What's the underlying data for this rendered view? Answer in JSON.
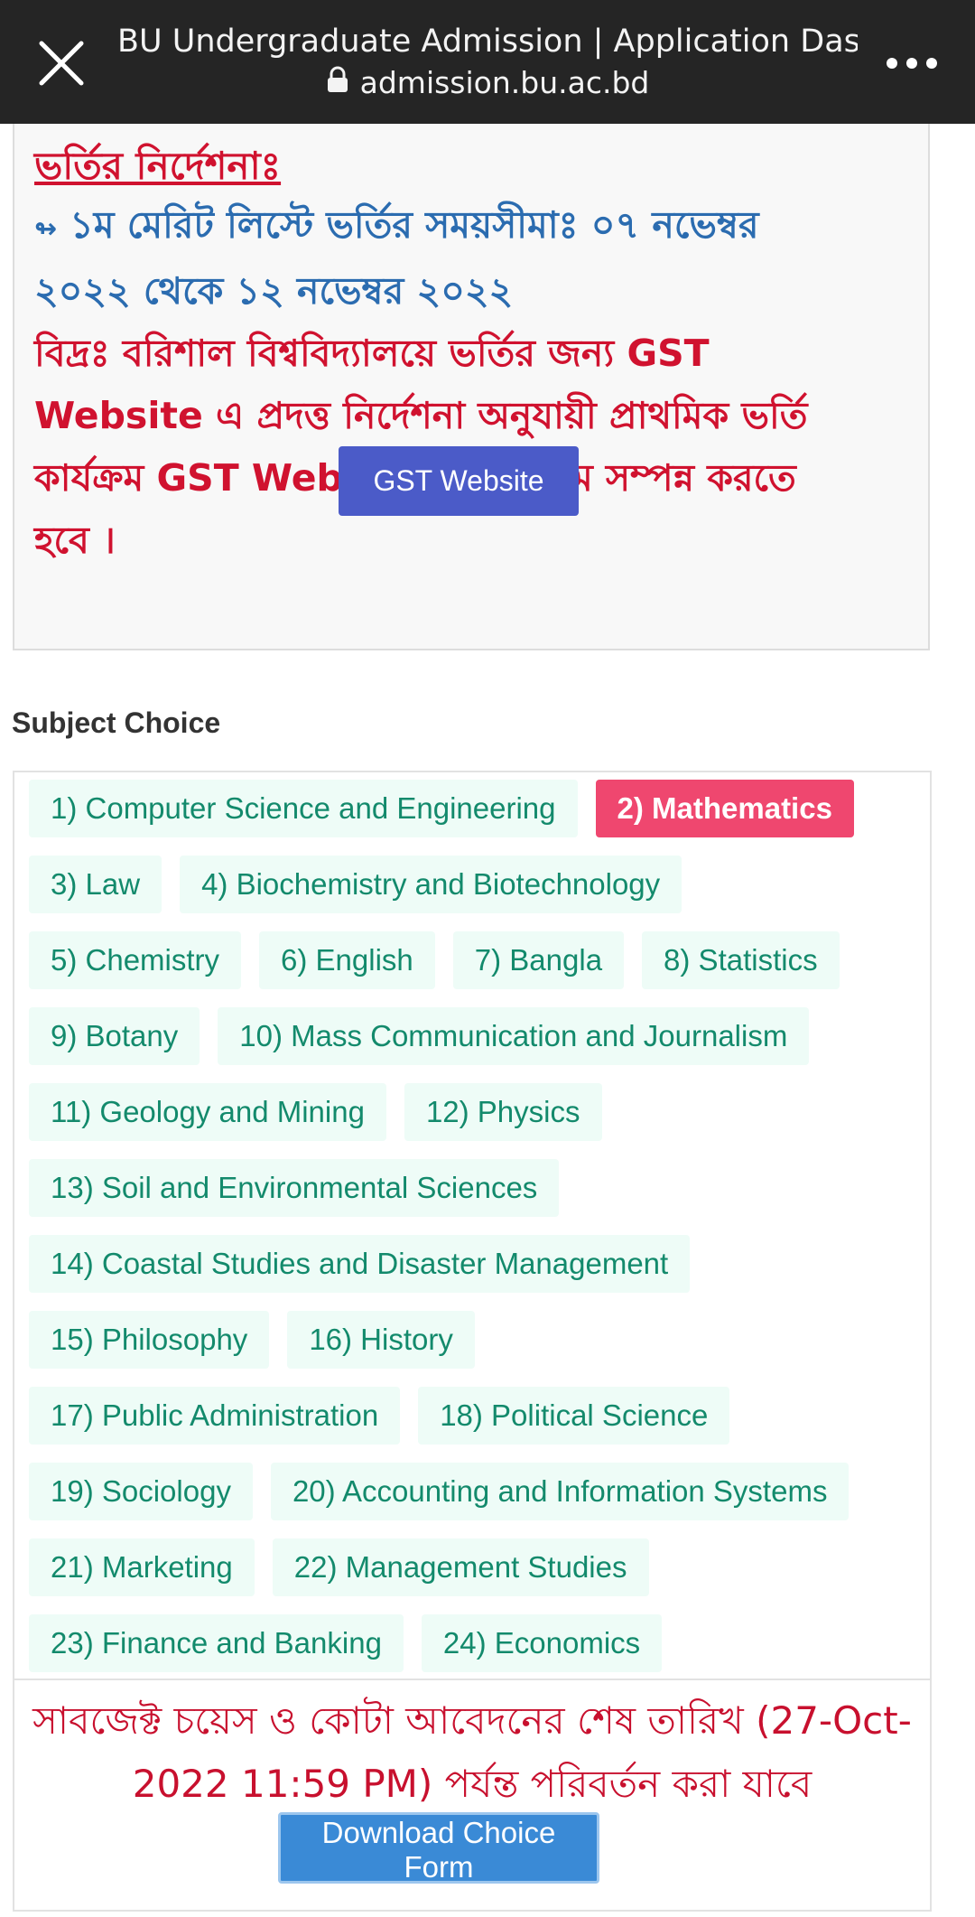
{
  "browser": {
    "title": "BU Undergraduate Admission | Application Das...",
    "url": "admission.bu.ac.bd",
    "close_icon": "close-icon",
    "more_icon": "more-vertical-dots-icon",
    "lock_icon": "lock-icon"
  },
  "notice": {
    "heading": "ভর্তির নির্দেশনাঃ",
    "line1": "১ম মেরিট লিস্টে ভর্তির সময়সীমাঃ ০৭ নভেম্বর",
    "line2": "২০২২ থেকে ১২ নভেম্বর ২০২২",
    "line3": "বিদ্রঃ বরিশাল বিশ্ববিদ্যালয়ে ভর্তির জন্য GST",
    "line4": "Website এ প্রদত্ত নির্দেশনা অনুযায়ী প্রাথমিক ভর্তি",
    "line5": "কার্যক্রম GST Website এর মাধ্যমে সম্পন্ন করতে",
    "line6": "হবে ।",
    "arrow": "↬",
    "button_label": "GST Website",
    "colors": {
      "blue": "#2b6cb0",
      "red": "#d0122f",
      "button": "#4b5bc8"
    }
  },
  "subjects": {
    "heading": "Subject Choice",
    "items": [
      "1) Computer Science and Engineering",
      "2) Mathematics",
      "3) Law",
      "4) Biochemistry and Biotechnology",
      "5) Chemistry",
      "6) English",
      "7) Bangla",
      "8) Statistics",
      "9) Botany",
      "10) Mass Communication and Journalism",
      "11) Geology and Mining",
      "12) Physics",
      "13) Soil and Environmental Sciences",
      "14) Coastal Studies and Disaster Management",
      "15) Philosophy",
      "16) History",
      "17) Public Administration",
      "18) Political Science",
      "19) Sociology",
      "20) Accounting and Information Systems",
      "21) Marketing",
      "22) Management Studies",
      "23) Finance and Banking",
      "24) Economics"
    ],
    "selected": "2) Mathematics",
    "colors": {
      "chip_bg": "#eefcf7",
      "chip_text": "#138a6c",
      "selected_bg": "#ef476f"
    }
  },
  "deadline": {
    "text": "সাবজেক্ট চয়েস ও কোটা আবেদনের শেষ তারিখ (27-Oct-2022 11:59 PM) পর্যন্ত পরিবর্তন করা যাবে",
    "button_label": "Download Choice Form",
    "colors": {
      "text": "#c8102e",
      "button": "#3a8ad6"
    }
  }
}
